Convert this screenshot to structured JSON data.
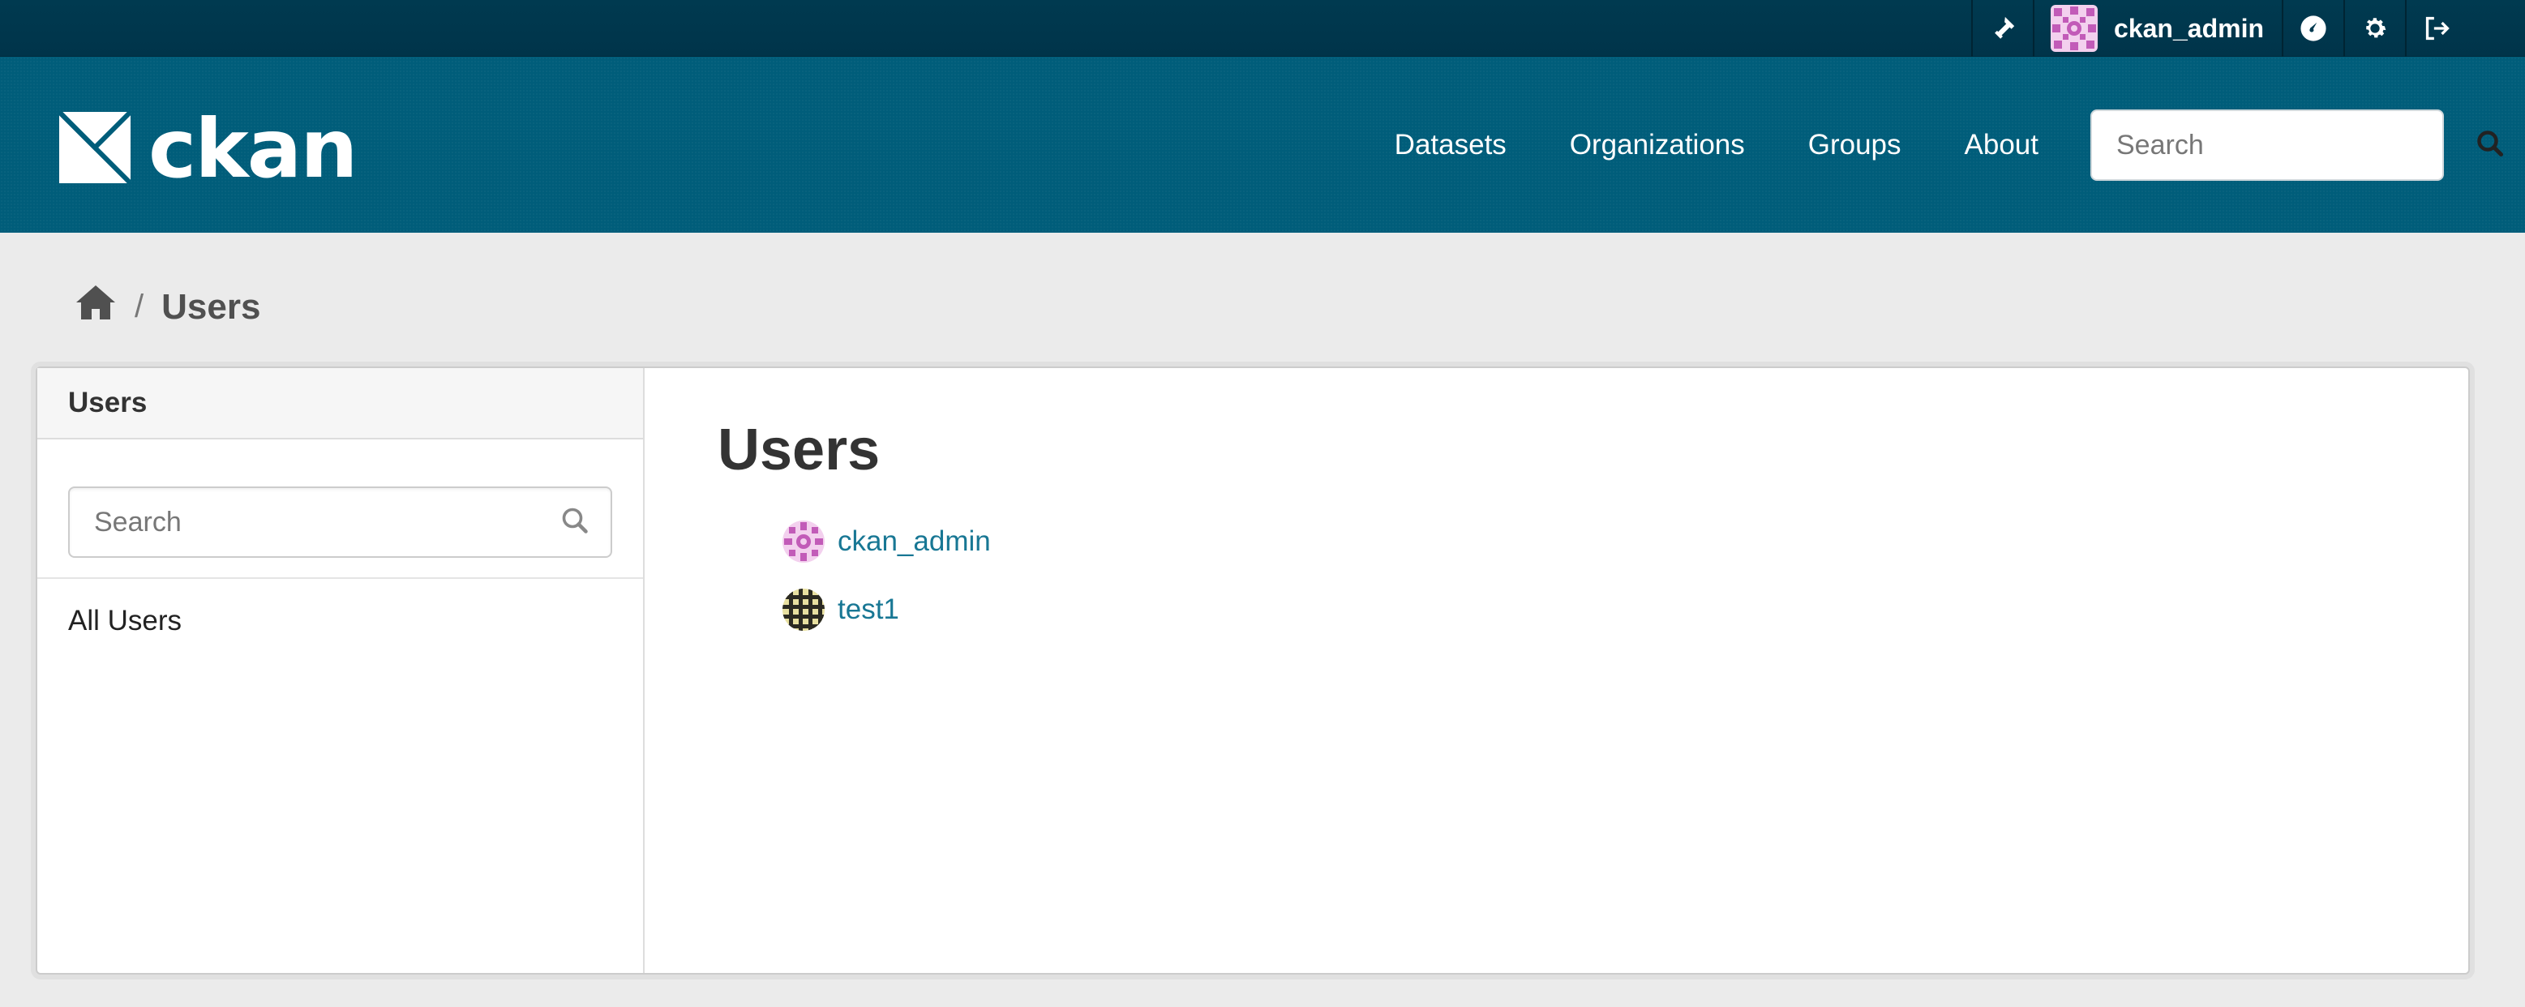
{
  "account": {
    "username": "ckan_admin",
    "icons": [
      "sysadmin-icon",
      "dashboard-icon",
      "settings-icon",
      "logout-icon"
    ]
  },
  "header": {
    "logo_text": "ckan",
    "nav": [
      {
        "label": "Datasets"
      },
      {
        "label": "Organizations"
      },
      {
        "label": "Groups"
      },
      {
        "label": "About"
      }
    ],
    "search_placeholder": "Search"
  },
  "breadcrumb": {
    "separator": "/",
    "current": "Users"
  },
  "sidebar": {
    "title": "Users",
    "search_placeholder": "Search",
    "all_users_label": "All Users"
  },
  "main": {
    "title": "Users",
    "users": [
      {
        "name": "ckan_admin"
      },
      {
        "name": "test1"
      }
    ]
  },
  "colors": {
    "account_bar": "#003a50",
    "masthead": "#005d7a",
    "link": "#187794",
    "background": "#ebebeb"
  }
}
